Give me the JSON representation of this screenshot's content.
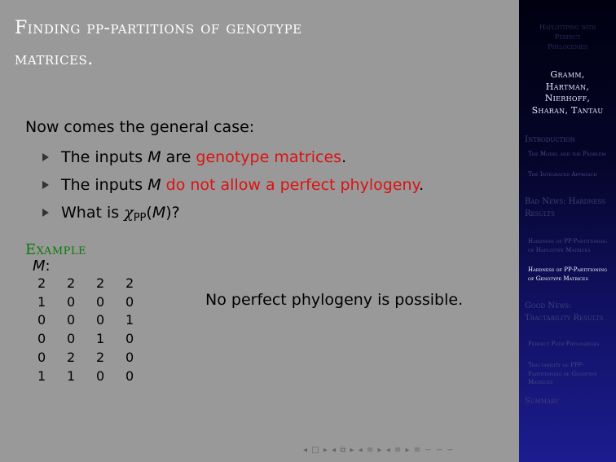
{
  "frame": {
    "title_line1": "Finding pp-partitions of genotype",
    "title_line2": "matrices."
  },
  "content": {
    "intro": "Now comes the general case:",
    "bullets": [
      {
        "pre": "The inputs ",
        "var": "M",
        "mid": " are ",
        "highlight": "genotype matrices",
        "post": "."
      },
      {
        "pre": "The inputs ",
        "var": "M",
        "mid": " ",
        "highlight": "do not allow a perfect phylogeny",
        "post": "."
      },
      {
        "pre": "What is ",
        "chi": "χ",
        "sub": "PP",
        "open": "(",
        "var": "M",
        "close": ")?"
      }
    ],
    "example": {
      "heading": "Example",
      "matrix_var": "M",
      "matrix_colon": ":",
      "matrix": [
        [
          "2",
          "2",
          "2",
          "2"
        ],
        [
          "1",
          "0",
          "0",
          "0"
        ],
        [
          "0",
          "0",
          "0",
          "1"
        ],
        [
          "0",
          "0",
          "1",
          "0"
        ],
        [
          "0",
          "2",
          "2",
          "0"
        ],
        [
          "1",
          "1",
          "0",
          "0"
        ]
      ],
      "note": "No perfect phylogeny is possible."
    },
    "nav_symbols": "◂ □ ▸ ◂ ⧉ ▸ ◂ ≡ ▸ ◂ ≡ ▸ ≡ ∽ ∽ ∽"
  },
  "sidebar": {
    "title_lines": [
      "Haplotyping with",
      "Perfect",
      "Phylogenies"
    ],
    "authors_lines": [
      "Gramm,",
      "Hartman,",
      "Nierhoff,",
      "Sharan, Tantau"
    ],
    "sections": [
      {
        "label": "Introduction",
        "subs": [
          "The Model and the Problem",
          "The Integrated Approach"
        ]
      },
      {
        "label": "Bad News: Hardness Results",
        "subs": [
          "Hardness of PP-Partitioning of Haplotype Matrices",
          "Hardness of PP-Partitioning of Genotype Matrices"
        ]
      },
      {
        "label": "Good News: Tractability Results",
        "subs": [
          "Perfect Path Phylogenies",
          "Tractability of PPP-Partitioning of Genotype Matrices"
        ]
      },
      {
        "label": "Summary",
        "subs": []
      }
    ]
  },
  "colors": {
    "background": "#999999",
    "highlight_red": "#dd1111",
    "example_green": "#0a7a0a",
    "sidebar_top": "#000010",
    "sidebar_bottom": "#1c1c90"
  }
}
